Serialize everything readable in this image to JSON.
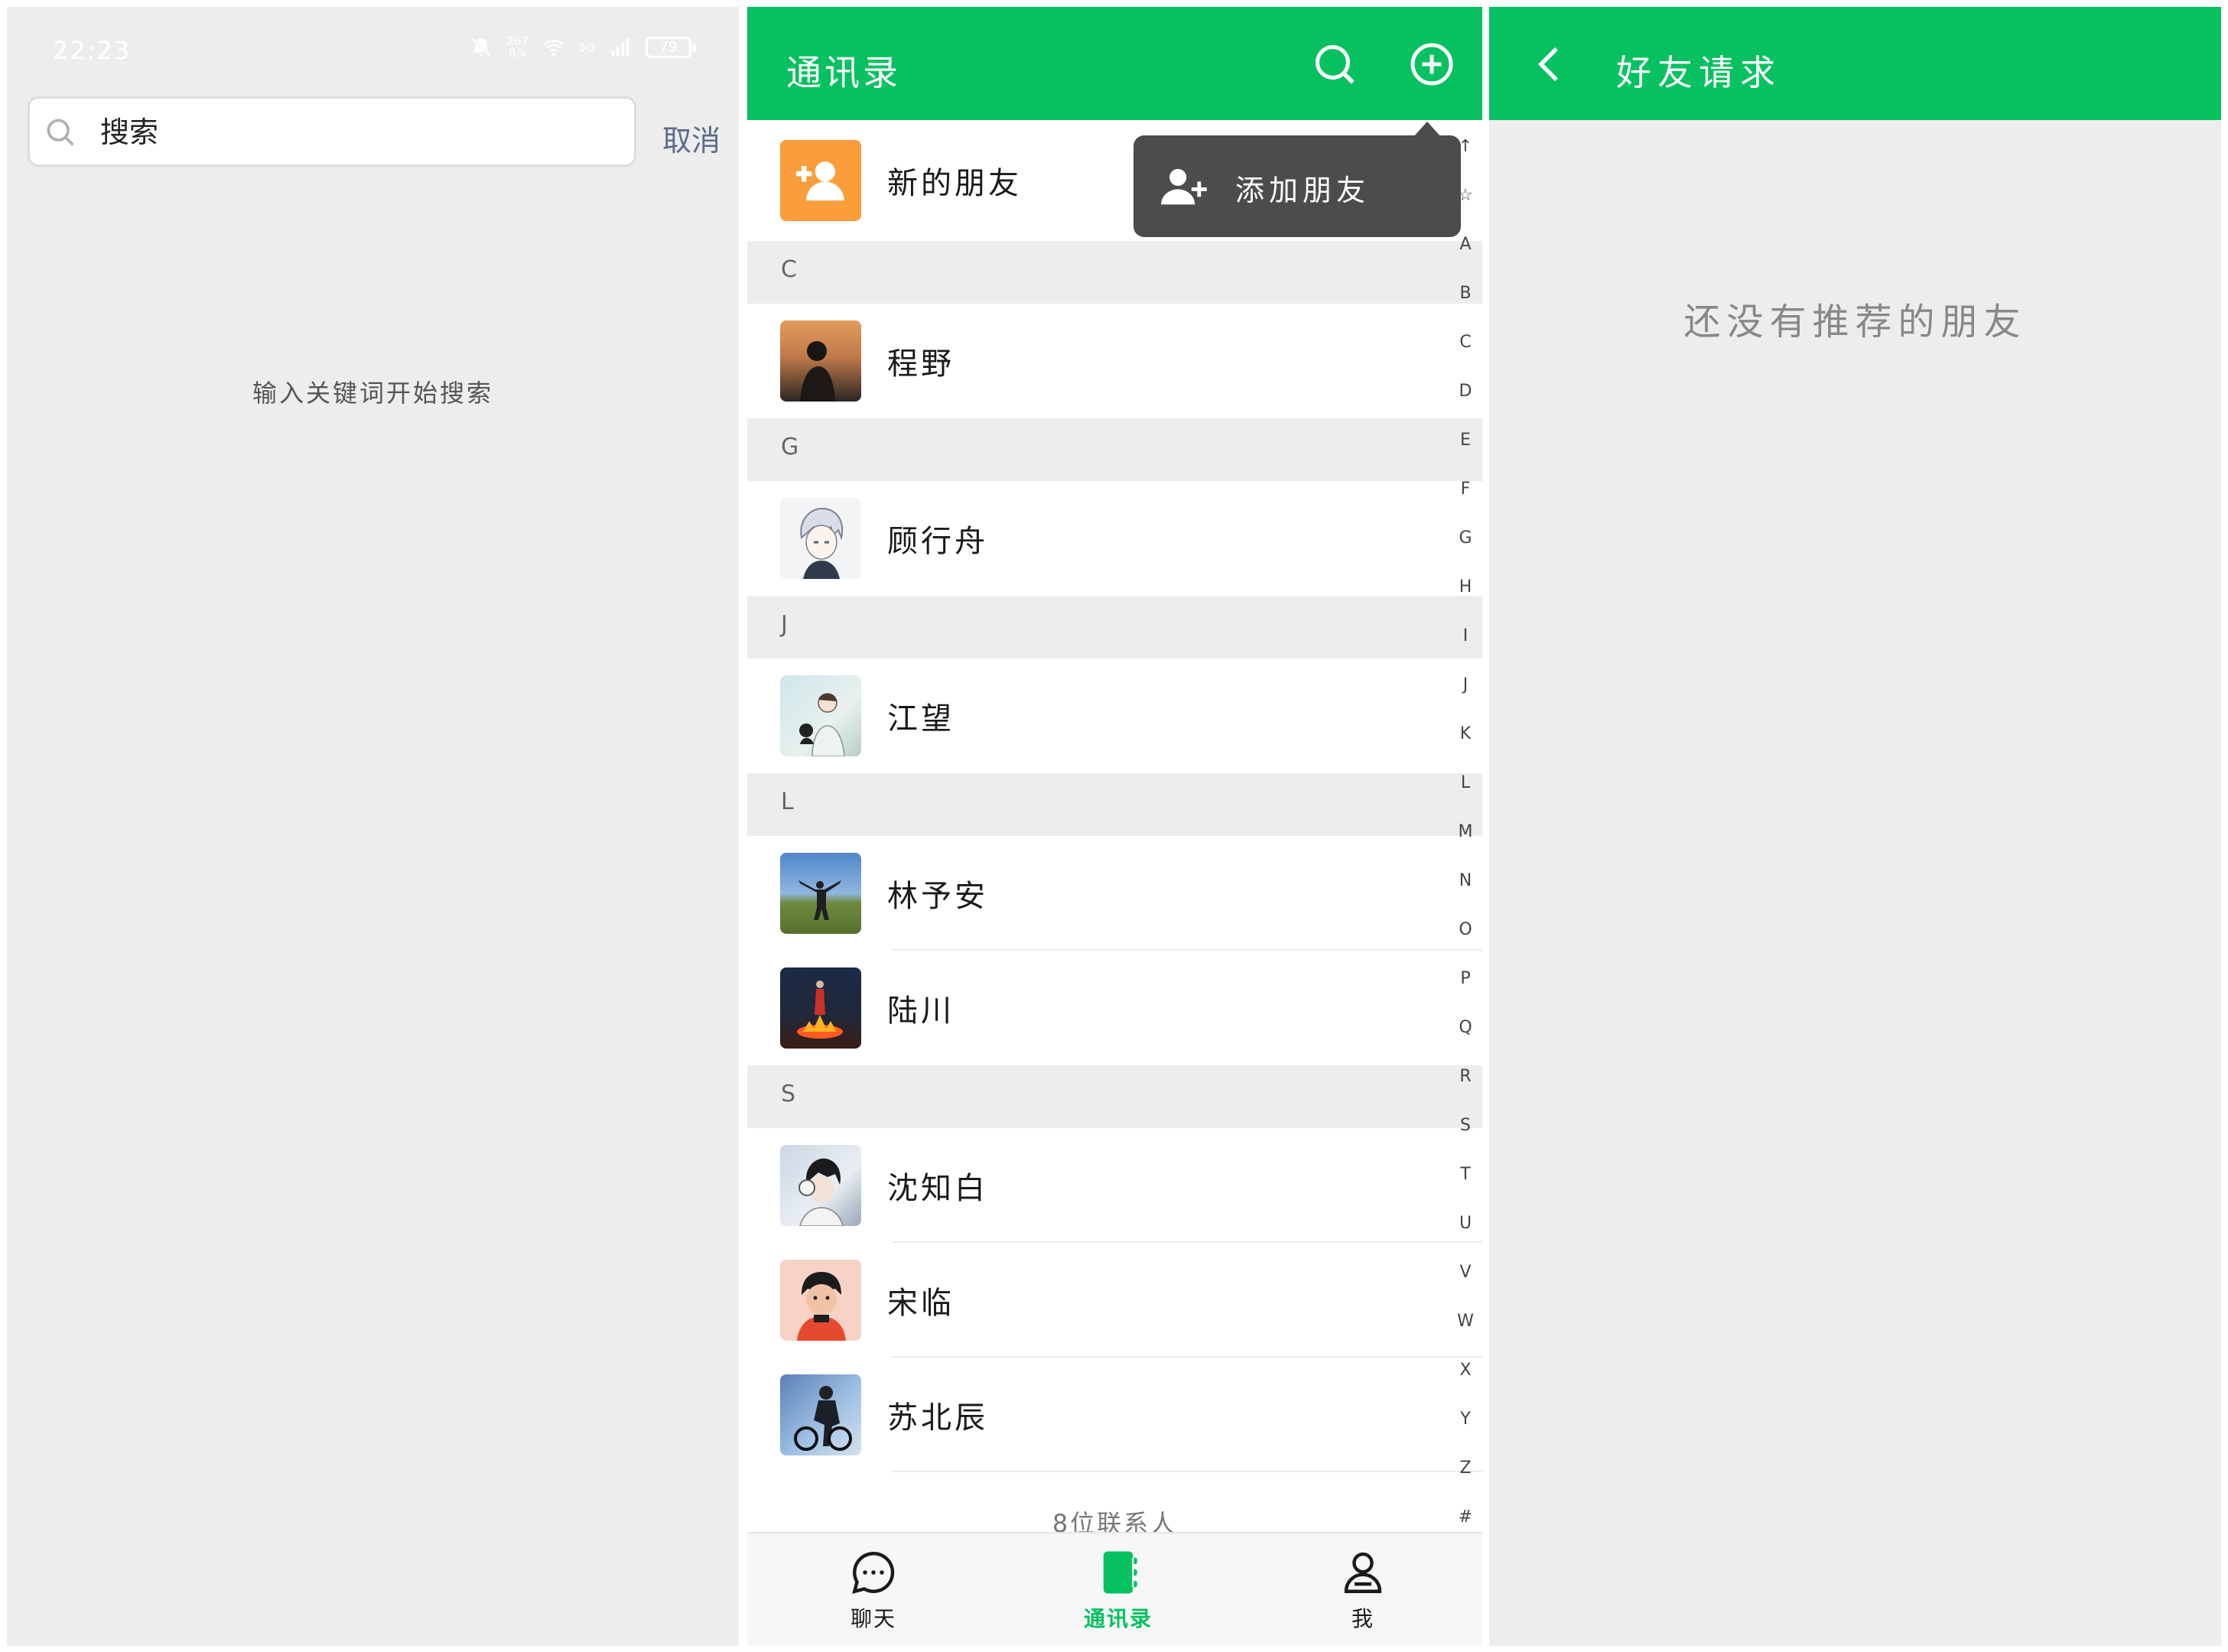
{
  "search_screen": {
    "status": {
      "time": "22:23",
      "net_speed_value": "267",
      "net_speed_unit": "B/s",
      "network_type": "5G",
      "battery": "79"
    },
    "search_placeholder": "搜索",
    "cancel_label": "取消",
    "hint": "输入关键词开始搜索"
  },
  "contacts_screen": {
    "title": "通讯录",
    "new_friends_label": "新的朋友",
    "popup_add_friend": "添加朋友",
    "sections": [
      {
        "letter": "C",
        "contacts": [
          "程野"
        ]
      },
      {
        "letter": "G",
        "contacts": [
          "顾行舟"
        ]
      },
      {
        "letter": "J",
        "contacts": [
          "江望"
        ]
      },
      {
        "letter": "L",
        "contacts": [
          "林予安",
          "陆川"
        ]
      },
      {
        "letter": "S",
        "contacts": [
          "沈知白",
          "宋临",
          "苏北辰"
        ]
      }
    ],
    "index_letters": [
      "↑",
      "☆",
      "A",
      "B",
      "C",
      "D",
      "E",
      "F",
      "G",
      "H",
      "I",
      "J",
      "K",
      "L",
      "M",
      "N",
      "O",
      "P",
      "Q",
      "R",
      "S",
      "T",
      "U",
      "V",
      "W",
      "X",
      "Y",
      "Z",
      "#"
    ],
    "contact_count": "8位联系人",
    "tabs": [
      {
        "label": "聊天",
        "icon": "chat-bubble-icon"
      },
      {
        "label": "通讯录",
        "icon": "address-book-icon"
      },
      {
        "label": "我",
        "icon": "person-icon"
      }
    ],
    "active_tab": "通讯录"
  },
  "requests_screen": {
    "title": "好友请求",
    "empty_message": "还没有推荐的朋友"
  },
  "colors": {
    "accent": "#07c160",
    "new_friend_tile": "#fa9d3b",
    "popup": "#4c4c4c",
    "background": "#ededed"
  }
}
